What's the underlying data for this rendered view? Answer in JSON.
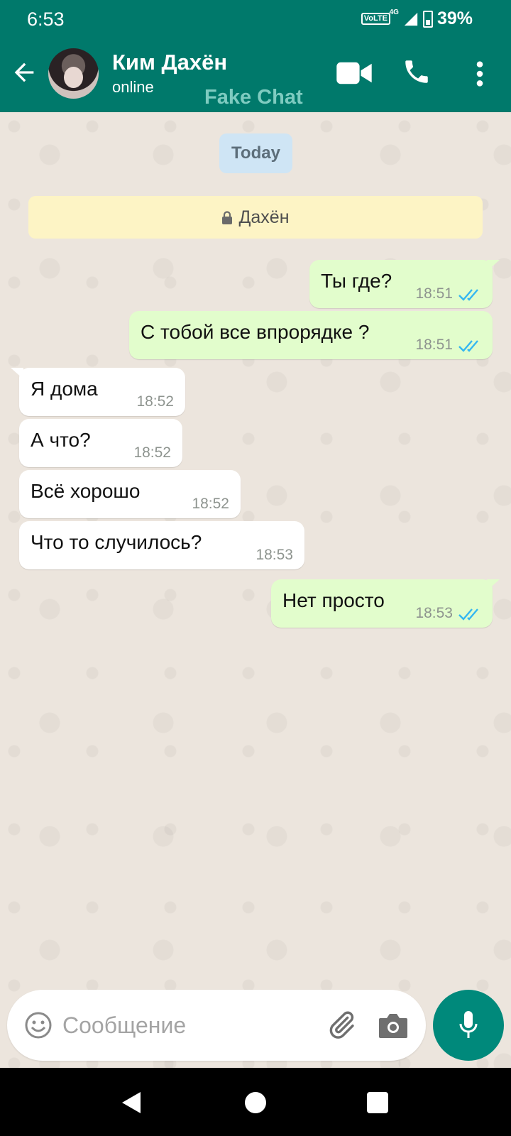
{
  "status_bar": {
    "time": "6:53",
    "network": "VoLTE",
    "net_type": "4G",
    "battery": "39%"
  },
  "header": {
    "name": "Ким Дахён",
    "status": "online",
    "watermark": "Fake Chat"
  },
  "chat": {
    "date_label": "Today",
    "encryption_label": "Дахён",
    "messages": [
      {
        "dir": "out",
        "text": "Ты где?",
        "time": "18:51",
        "read": true
      },
      {
        "dir": "out",
        "text": "С тобой все впрорядке ?",
        "time": "18:51",
        "read": true
      },
      {
        "dir": "in",
        "text": "Я дома",
        "time": "18:52"
      },
      {
        "dir": "in",
        "text": "А что?",
        "time": "18:52"
      },
      {
        "dir": "in",
        "text": "Всё хорошо",
        "time": "18:52"
      },
      {
        "dir": "in",
        "text": "Что то случилось?",
        "time": "18:53"
      },
      {
        "dir": "out",
        "text": "Нет просто",
        "time": "18:53",
        "read": true
      }
    ]
  },
  "composer": {
    "placeholder": "Сообщение"
  },
  "colors": {
    "header": "#00796b",
    "outgoing": "#e2fdcc",
    "incoming": "#ffffff",
    "tick": "#34b7f1"
  },
  "icons": [
    "back-arrow-icon",
    "video-call-icon",
    "phone-icon",
    "more-vert-icon",
    "lock-icon",
    "emoji-icon",
    "attach-icon",
    "camera-icon",
    "mic-icon"
  ]
}
